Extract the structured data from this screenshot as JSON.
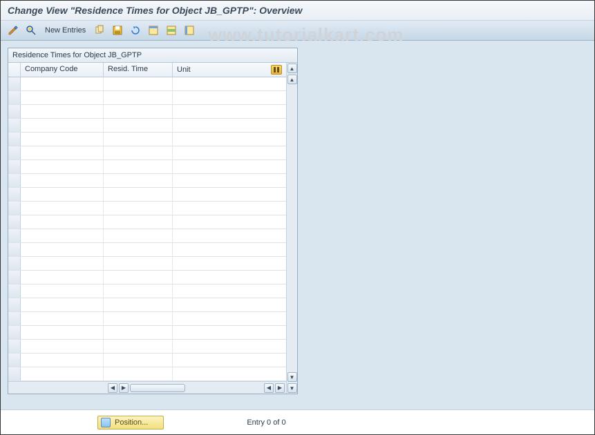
{
  "page_title": "Change View \"Residence Times for Object JB_GPTP\": Overview",
  "watermark": "www.tutorialkart.com",
  "toolbar": {
    "new_entries_label": "New Entries"
  },
  "panel": {
    "title": "Residence Times for Object JB_GPTP",
    "columns": {
      "company_code": "Company Code",
      "resid_time": "Resid. Time",
      "unit": "Unit"
    }
  },
  "footer": {
    "position_label": "Position...",
    "entry_status": "Entry 0 of 0"
  }
}
